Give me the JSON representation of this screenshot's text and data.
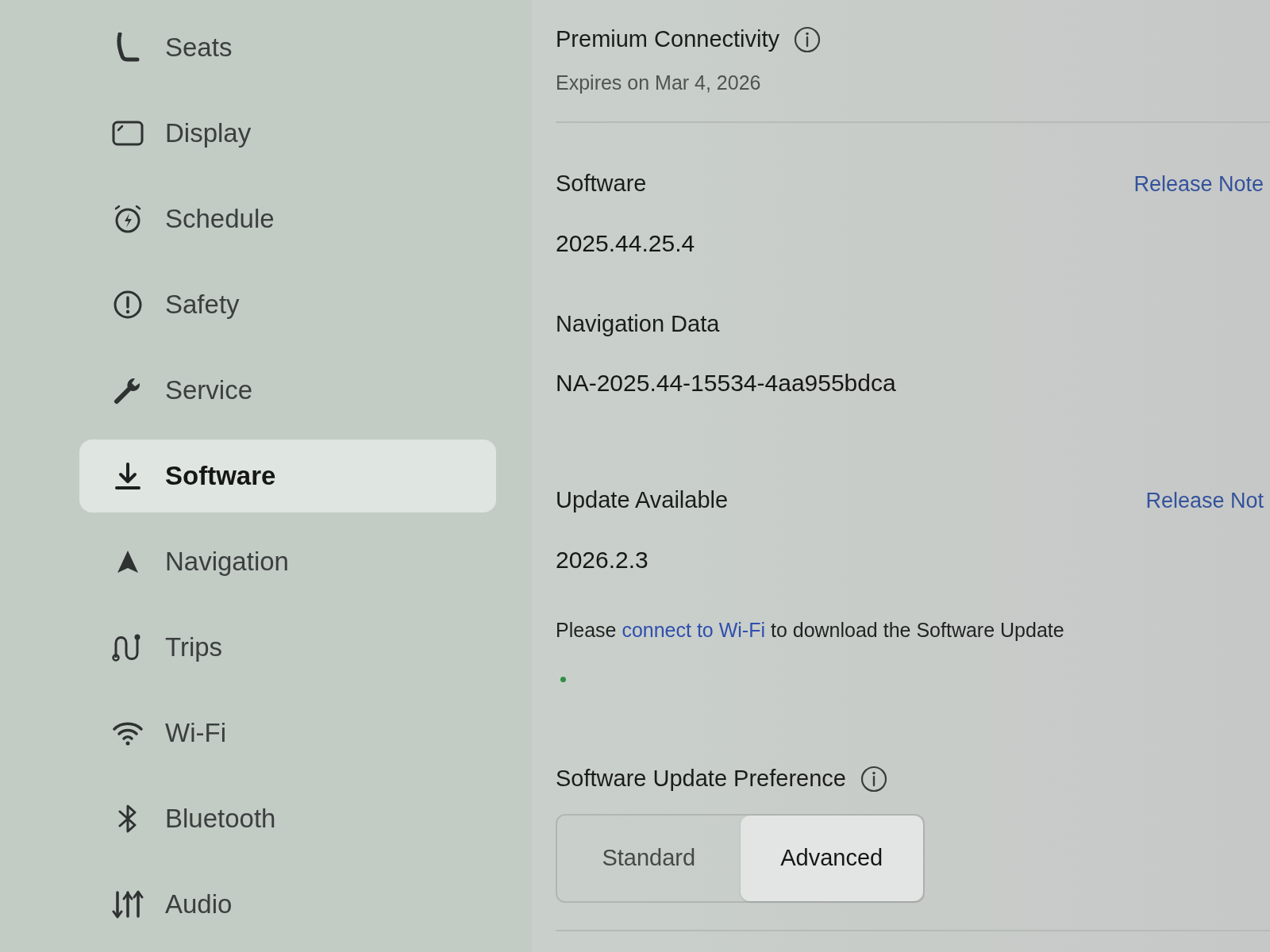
{
  "sidebar": {
    "items": [
      {
        "label": "Seats",
        "selected": false
      },
      {
        "label": "Display",
        "selected": false
      },
      {
        "label": "Schedule",
        "selected": false
      },
      {
        "label": "Safety",
        "selected": false
      },
      {
        "label": "Service",
        "selected": false
      },
      {
        "label": "Software",
        "selected": true
      },
      {
        "label": "Navigation",
        "selected": false
      },
      {
        "label": "Trips",
        "selected": false
      },
      {
        "label": "Wi-Fi",
        "selected": false
      },
      {
        "label": "Bluetooth",
        "selected": false
      },
      {
        "label": "Audio",
        "selected": false
      }
    ]
  },
  "connectivity": {
    "title": "Premium Connectivity",
    "subtitle": "Expires on Mar 4, 2026"
  },
  "software": {
    "label": "Software",
    "link": "Release Note",
    "value": "2025.44.25.4"
  },
  "navigation_data": {
    "label": "Navigation Data",
    "value": "NA-2025.44-15534-4aa955bdca"
  },
  "update": {
    "label": "Update Available",
    "link": "Release Not",
    "value": "2026.2.3",
    "message": {
      "before": "Please",
      "link": "connect to Wi-Fi",
      "after": "to download the Software Update"
    }
  },
  "preference": {
    "title": "Software Update Preference",
    "options": [
      {
        "label": "Standard",
        "selected": false
      },
      {
        "label": "Advanced",
        "selected": true
      }
    ]
  }
}
